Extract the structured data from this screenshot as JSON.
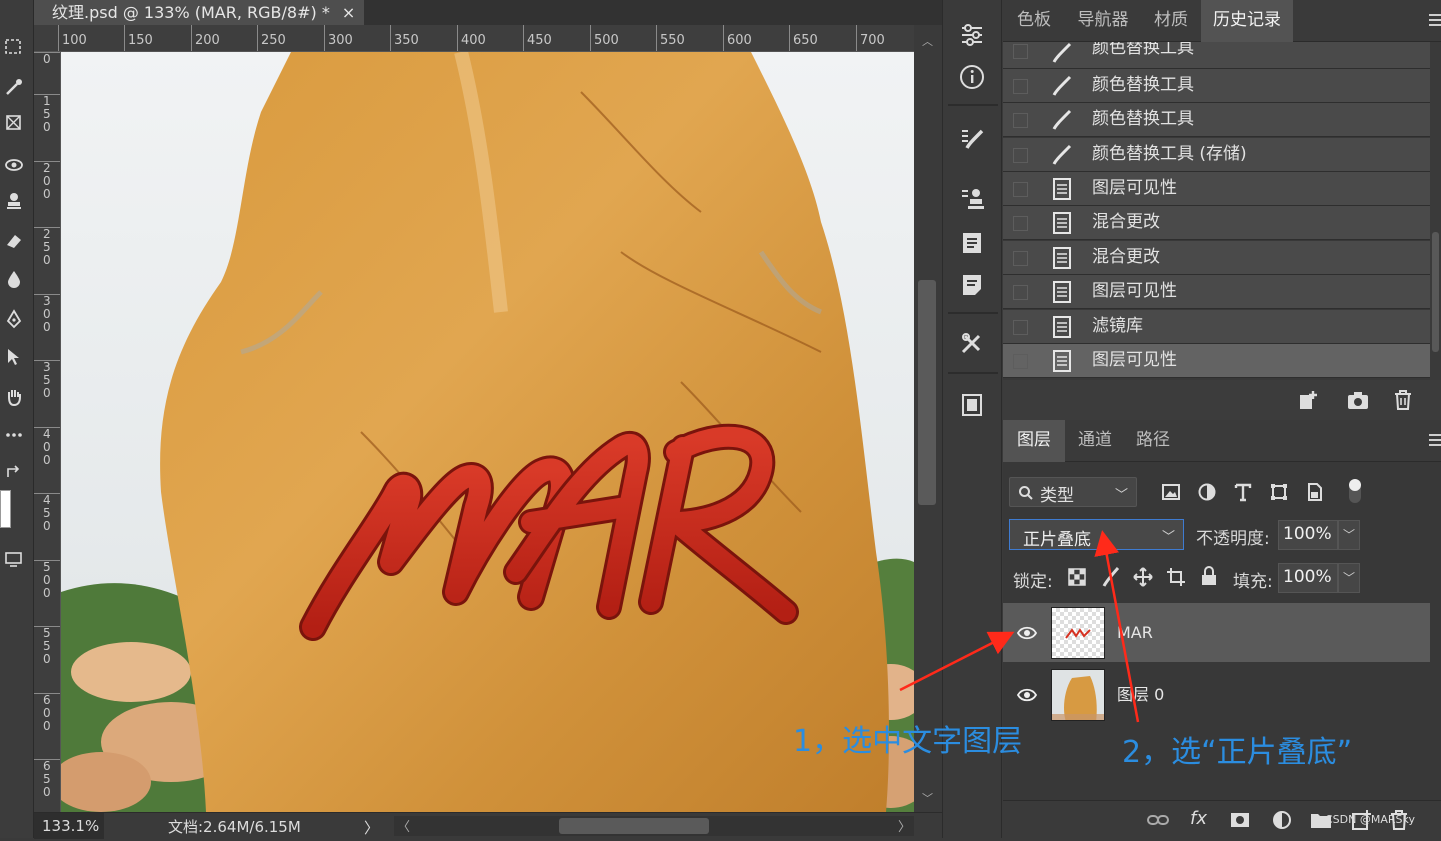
{
  "document": {
    "tab_title": "纹理.psd @ 133% (MAR, RGB/8#) *",
    "close_glyph": "×",
    "zoom": "133.1%",
    "doc_size": "文档:2.64M/6.15M",
    "status_arrow": "〉",
    "hscroll_left": "〈",
    "hscroll_right": "〉"
  },
  "rulers": {
    "horizontal": [
      "100",
      "150",
      "200",
      "250",
      "300",
      "350",
      "400",
      "450",
      "500",
      "550",
      "600",
      "650",
      "700"
    ],
    "vertical": [
      "0",
      "1\n5\n0",
      "2\n0\n0",
      "2\n5\n0",
      "3\n0\n0",
      "3\n5\n0",
      "4\n0\n0",
      "4\n5\n0",
      "5\n0\n0",
      "5\n5\n0",
      "6\n0\n0",
      "6\n5\n0"
    ]
  },
  "canvas": {
    "text": "MAR"
  },
  "history_panel": {
    "tabs": [
      "色板",
      "导航器",
      "材质",
      "历史记录"
    ],
    "active_tab": "历史记录",
    "items": [
      {
        "label": "颜色替换工具",
        "icon": "brush-icon"
      },
      {
        "label": "颜色替换工具",
        "icon": "brush-icon"
      },
      {
        "label": "颜色替换工具",
        "icon": "brush-icon"
      },
      {
        "label": "颜色替换工具 (存储)",
        "icon": "brush-icon"
      },
      {
        "label": "图层可见性",
        "icon": "document-icon"
      },
      {
        "label": "混合更改",
        "icon": "document-icon"
      },
      {
        "label": "混合更改",
        "icon": "document-icon"
      },
      {
        "label": "图层可见性",
        "icon": "document-icon"
      },
      {
        "label": "滤镜库",
        "icon": "document-icon"
      },
      {
        "label": "图层可见性",
        "icon": "document-icon"
      }
    ],
    "footer_icons": [
      "new-document-from-state-icon",
      "camera-icon",
      "trash-icon"
    ]
  },
  "layers_panel": {
    "tabs": [
      "图层",
      "通道",
      "路径"
    ],
    "active_tab": "图层",
    "filter_kind": "类型",
    "blend_mode": "正片叠底",
    "opacity_label": "不透明度:",
    "opacity_value": "100%",
    "lock_label": "锁定:",
    "fill_label": "填充:",
    "fill_value": "100%",
    "layers": [
      {
        "name": "MAR",
        "thumb": "text-thumbnail",
        "selected": true
      },
      {
        "name": "图层 0",
        "thumb": "rock-thumbnail",
        "selected": false
      }
    ],
    "footer_icons": [
      "link-icon",
      "fx-icon",
      "mask-icon",
      "adjustment-icon",
      "folder-icon",
      "new-layer-icon",
      "trash-icon"
    ],
    "fx_label": "fx"
  },
  "annotations": {
    "step1": "1，选中文字图层",
    "step2": "2，选“正片叠底”"
  },
  "colors": {
    "annotation": "#2b8de0",
    "arrow": "#ff2a1a",
    "selection_border": "#3e7bd1"
  },
  "watermark": "CSDN @MARSky"
}
